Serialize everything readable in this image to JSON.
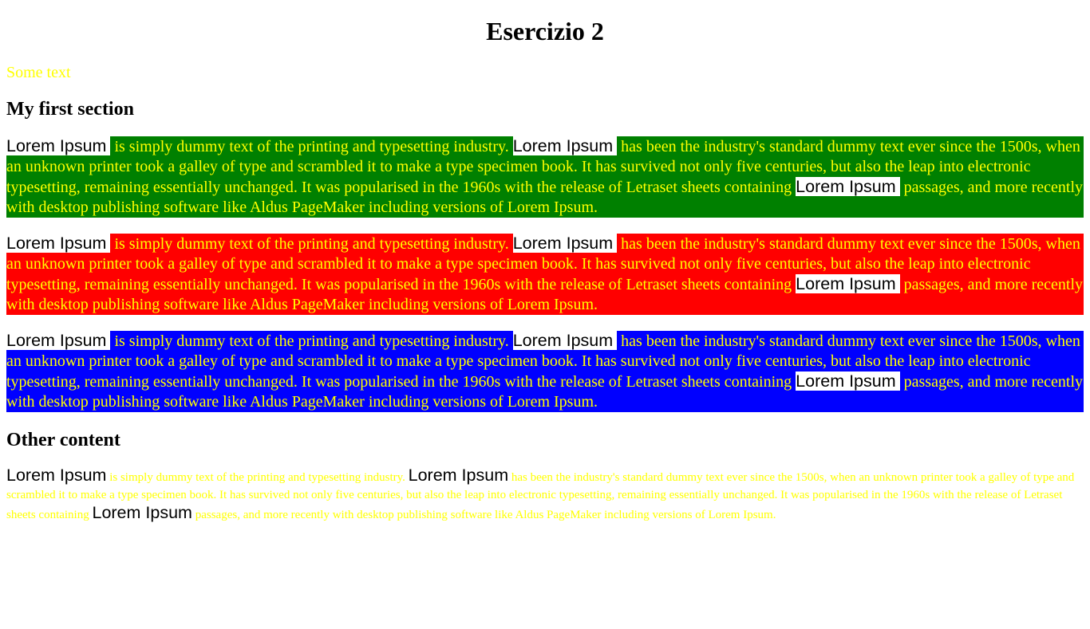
{
  "page": {
    "title": "Esercizio 2",
    "some_text": "Some text",
    "section1_heading": "My first section",
    "section2_heading": "Other content"
  },
  "paragraph": {
    "lorem": "Lorem Ipsum",
    "seg1": " is simply dummy text of the printing and typesetting industry. ",
    "seg2": " has been the industry's standard dummy text ever since the 1500s, when an unknown printer took a galley of type and scrambled it to make a type specimen book. It has survived not only five centuries, but also the leap into electronic typesetting, remaining essentially unchanged. It was popularised in the 1960s with the release of Letraset sheets containing ",
    "seg3": " passages, and more recently with desktop publishing software like Aldus PageMaker including versions of Lorem Ipsum."
  },
  "colors": {
    "text_yellow": "#ffff00",
    "green_bg": "#008000",
    "red_bg": "#ff0000",
    "blue_bg": "#0000ff"
  }
}
